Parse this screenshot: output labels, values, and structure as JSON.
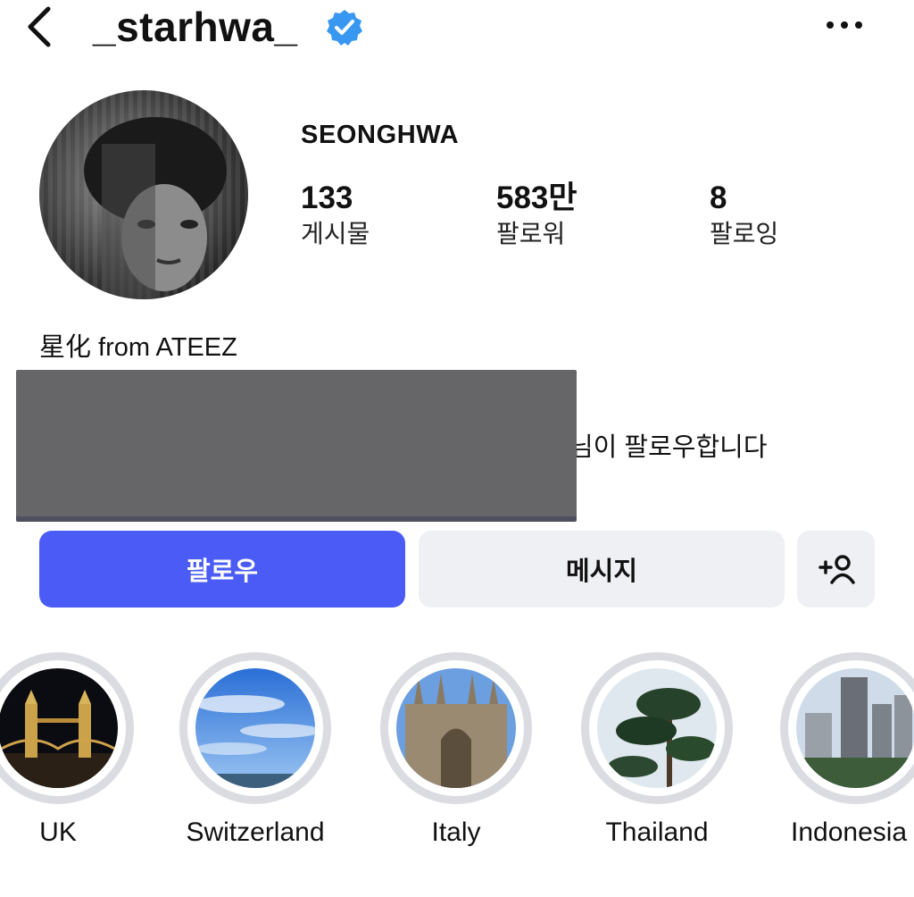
{
  "header": {
    "username": "_starhwa_",
    "verified_icon": "verified-badge-icon",
    "back_icon": "chevron-left-icon",
    "more_icon": "more-horizontal-icon"
  },
  "profile": {
    "display_name": "SEONGHWA",
    "stats": [
      {
        "value": "133",
        "label": "게시물"
      },
      {
        "value": "583만",
        "label": "팔로워"
      },
      {
        "value": "8",
        "label": "팔로잉"
      }
    ],
    "bio": "星化 from ATEEZ",
    "followed_by_suffix": "님이 팔로우합니다"
  },
  "actions": {
    "follow_label": "팔로우",
    "message_label": "메시지",
    "add_user_icon": "add-person-icon"
  },
  "highlights": [
    {
      "label": "UK"
    },
    {
      "label": "Switzerland"
    },
    {
      "label": "Italy"
    },
    {
      "label": "Thailand"
    },
    {
      "label": "Indonesia"
    }
  ],
  "colors": {
    "follow_button": "#4a5cf5",
    "secondary_button": "#eff0f4",
    "verified": "#3897f0",
    "highlight_ring": "#dbdbe2"
  }
}
